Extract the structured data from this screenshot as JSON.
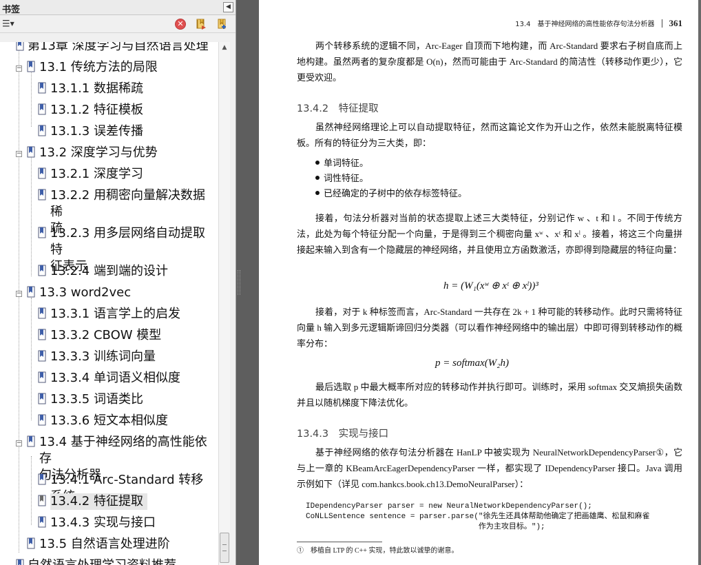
{
  "panel": {
    "title": "书签",
    "options_glyph": "☰",
    "delete_glyph": "✕"
  },
  "bookmarks": [
    {
      "label": "第13章 深度学习与自然语言处理",
      "level": 0,
      "toggle": "",
      "partial": true
    },
    {
      "label": "13.1 传统方法的局限",
      "level": 1,
      "toggle": "−"
    },
    {
      "label": "13.1.1 数据稀疏",
      "level": 2
    },
    {
      "label": "13.1.2 特征模板",
      "level": 2
    },
    {
      "label": "13.1.3 误差传播",
      "level": 2
    },
    {
      "label": "13.2 深度学习与优势",
      "level": 1,
      "toggle": "−"
    },
    {
      "label": "13.2.1 深度学习",
      "level": 2
    },
    {
      "label": "13.2.2 用稠密向量解决数据稀",
      "label2": "疏",
      "level": 2
    },
    {
      "label": "13.2.3 用多层网络自动提取特",
      "label2": "征表示",
      "level": 2
    },
    {
      "label": "13.2.4 端到端的设计",
      "level": 2
    },
    {
      "label": "13.3 word2vec",
      "level": 1,
      "toggle": "−"
    },
    {
      "label": "13.3.1 语言学上的启发",
      "level": 2
    },
    {
      "label": "13.3.2 CBOW 模型",
      "level": 2
    },
    {
      "label": "13.3.3 训练词向量",
      "level": 2
    },
    {
      "label": "13.3.4 单词语义相似度",
      "level": 2
    },
    {
      "label": "13.3.5 词语类比",
      "level": 2
    },
    {
      "label": "13.3.6 短文本相似度",
      "level": 2
    },
    {
      "label": "13.4 基于神经网络的高性能依存",
      "label2": "句法分析器",
      "level": 1,
      "toggle": "−"
    },
    {
      "label": "13.4.1 Arc-Standard 转移系统",
      "level": 2
    },
    {
      "label": "13.4.2 特征提取",
      "level": 2,
      "selected": true
    },
    {
      "label": "13.4.3 实现与接口",
      "level": 2
    },
    {
      "label": "13.5 自然语言处理进阶",
      "level": 1
    },
    {
      "label": "自然语言处理学习资料推荐",
      "level": 0,
      "partial": true
    }
  ],
  "page": {
    "running_head": "13.4　基于神经网络的高性能依存句法分析器",
    "page_number": "361",
    "para1": "两个转移系统的逻辑不同，Arc-Eager 自顶而下地构建，而 Arc-Standard 要求右子树自底而上地构建。虽然两者的复杂度都是 O(n)，然而可能由于 Arc-Standard 的简洁性（转移动作更少），它更受欢迎。",
    "h1": "13.4.2　特征提取",
    "para2": "虽然神经网络理论上可以自动提取特征，然而这篇论文作为开山之作，依然未能脱离特征模板。所有的特征分为三大类，即：",
    "bullets": [
      "单词特征。",
      "词性特征。",
      "已经确定的子树中的依存标签特征。"
    ],
    "para3": "接着，句法分析器对当前的状态提取上述三大类特征，分别记作 w 、t 和 l 。不同于传统方法，此处为每个特征分配一个向量，于是得到三个稠密向量 xʷ 、xᵗ 和 xˡ 。接着，将这三个向量拼接起来输入到含有一个隐藏层的神经网络，并且使用立方函数激活，亦即得到隐藏层的特征向量：",
    "formula1": "h = (W₁(xʷ ⊕ xᵗ ⊕ xˡ))³",
    "para4": "接着，对于 k 种标签而言，Arc-Standard 一共存在 2k + 1 种可能的转移动作。此时只需将特征向量 h 输入到多元逻辑斯谛回归分类器（可以看作神经网络中的输出层）中即可得到转移动作的概率分布：",
    "formula2": "p = softmax(W₂h)",
    "para5": "最后选取 p 中最大概率所对应的转移动作并执行即可。训练时，采用 softmax 交叉熵损失函数并且以随机梯度下降法优化。",
    "h2": "13.4.3　实现与接口",
    "para6": "基于神经网络的依存句法分析器在 HanLP 中被实现为 NeuralNetworkDependencyParser①，它与上一章的 KBeamArcEagerDependencyParser 一样，都实现了 IDependencyParser 接口。Java 调用示例如下（详见 com.hankcs.book.ch13.DemoNeuralParser）：",
    "code": "IDependencyParser parser = new NeuralNetworkDependencyParser();\nCoNLLSentence sentence = parser.parse(\"徐先生还具体帮助他确定了把画雄鹰、松鼠和麻雀\n                                      作为主攻目标。\");",
    "footnote": "①　移植自 LTP 的 C++ 实现，特此致以诚挚的谢意。"
  }
}
